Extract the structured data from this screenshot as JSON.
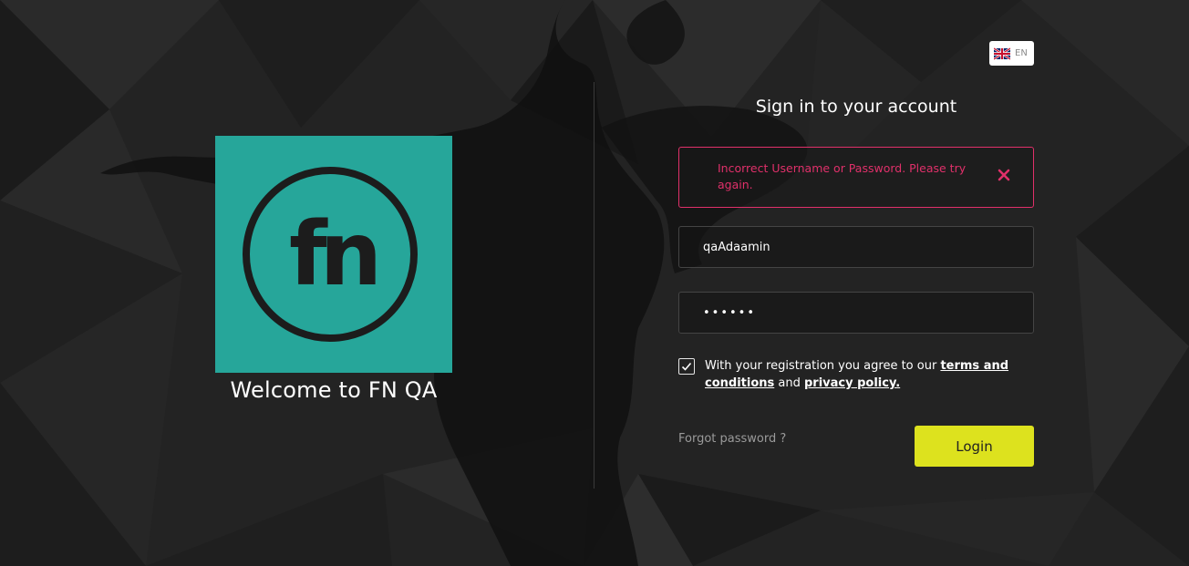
{
  "language": {
    "code": "EN",
    "flag_icon": "uk-flag-icon"
  },
  "brand": {
    "logo_text": "fn",
    "logo_color": "#26a69a",
    "welcome": "Welcome to FN QA"
  },
  "form": {
    "title": "Sign in to your account",
    "error": {
      "message": "Incorrect Username or Password. Please try again.",
      "color": "#e0306a",
      "close_icon": "close-icon"
    },
    "username": {
      "value": "qaAdaamin"
    },
    "password": {
      "value": "••••••"
    },
    "terms": {
      "checked": true,
      "prefix": "With your registration you agree to our ",
      "terms_link": "terms and conditions",
      "middle": " and ",
      "privacy_link": "privacy policy."
    },
    "forgot_password": "Forgot password ?",
    "login_label": "Login",
    "login_color": "#dde21e"
  }
}
